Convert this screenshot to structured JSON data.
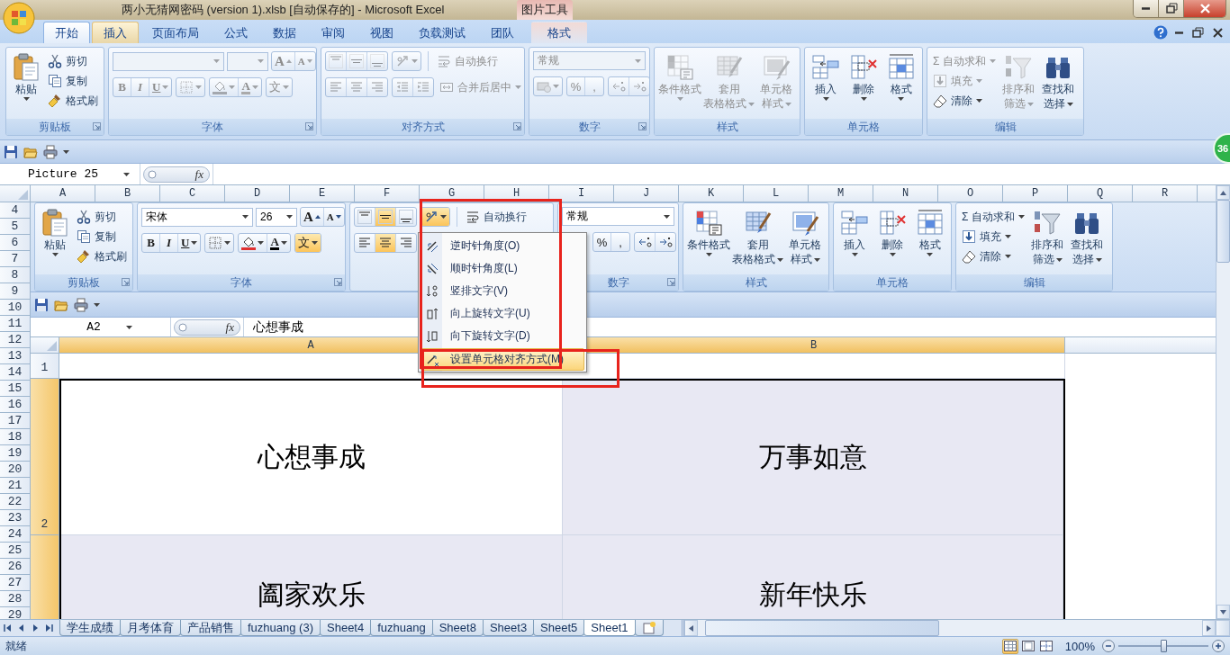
{
  "title_bar": {
    "title": "两小无猜网密码 (version 1).xlsb [自动保存的] - Microsoft Excel",
    "context_label": "图片工具"
  },
  "ribbon_tabs": [
    {
      "label": "开始",
      "selected": true,
      "hovered": false
    },
    {
      "label": "插入",
      "selected": false,
      "hovered": true
    },
    {
      "label": "页面布局",
      "selected": false,
      "hovered": false
    },
    {
      "label": "公式",
      "selected": false,
      "hovered": false
    },
    {
      "label": "数据",
      "selected": false,
      "hovered": false
    },
    {
      "label": "审阅",
      "selected": false,
      "hovered": false
    },
    {
      "label": "视图",
      "selected": false,
      "hovered": false
    },
    {
      "label": "负载测试",
      "selected": false,
      "hovered": false
    },
    {
      "label": "团队",
      "selected": false,
      "hovered": false
    }
  ],
  "context_tabs": [
    {
      "label": "格式",
      "selected": false,
      "hovered": false
    }
  ],
  "ribbon": {
    "clipboard": {
      "label": "剪贴板",
      "paste": {
        "label": "粘贴"
      },
      "cut": {
        "label": "剪切"
      },
      "copy": {
        "label": "复制"
      },
      "painter": {
        "label": "格式刷"
      }
    },
    "font": {
      "label": "字体",
      "disabled": true,
      "grow": "A",
      "shrink": "A",
      "bold": "B",
      "italic": "I",
      "underline": "U",
      "font_color": "A",
      "phonetic": {
        "glyph": "文",
        "pressed": false
      }
    },
    "alignment": {
      "label": "对齐方式",
      "disabled": true,
      "top": {
        "pressed": false
      },
      "middle": {
        "pressed": false
      },
      "bottom": {
        "pressed": false
      },
      "orientation": {
        "pressed": false
      },
      "left": {
        "pressed": false
      },
      "center": {
        "pressed": false
      },
      "right": {
        "pressed": false
      },
      "wrap": {
        "label": "自动换行"
      },
      "merge": {
        "label": "合并后居中"
      }
    },
    "number": {
      "label": "数字",
      "disabled": true,
      "format": {
        "value": "常规"
      },
      "currency": {
        "dropdown": true
      },
      "percent": "%",
      "comma": ","
    },
    "styles": {
      "label": "样式",
      "disabled": true,
      "conditional": {
        "lines": [
          "条件格式"
        ]
      },
      "table": {
        "lines": [
          "套用",
          "表格格式"
        ]
      },
      "cell_styles": {
        "lines": [
          "单元格",
          "样式"
        ]
      }
    },
    "cells": {
      "label": "单元格",
      "insert": {
        "lines": [
          "插入"
        ]
      },
      "delete": {
        "lines": [
          "删除"
        ]
      },
      "format": {
        "lines": [
          "格式"
        ]
      }
    },
    "editing": {
      "label": "编辑",
      "autosum": {
        "icon": "Σ",
        "label": "自动求和",
        "disabled": true
      },
      "fill": {
        "label": "填充",
        "disabled": true
      },
      "clear": {
        "label": "清除",
        "disabled": false
      },
      "sort": {
        "lines": [
          "排序和",
          "筛选"
        ],
        "disabled": true
      },
      "find": {
        "lines": [
          "查找和",
          "选择"
        ],
        "disabled": false
      }
    }
  },
  "formula_bar": {
    "name_box": "Picture 25",
    "function_label": "fx"
  },
  "columns": [
    "A",
    "B",
    "C",
    "D",
    "E",
    "F",
    "G",
    "H",
    "I",
    "J",
    "K",
    "L",
    "M",
    "N",
    "O",
    "P",
    "Q",
    "R"
  ],
  "rows": [
    "4",
    "5",
    "6",
    "7",
    "8",
    "9",
    "10",
    "11",
    "12",
    "13",
    "14",
    "15",
    "16",
    "17",
    "18",
    "19",
    "20",
    "21",
    "22",
    "23",
    "24",
    "25",
    "26",
    "27",
    "28",
    "29"
  ],
  "picture": {
    "ribbon": {
      "clipboard": {
        "label": "剪贴板",
        "paste": {
          "label": "粘贴"
        },
        "cut": {
          "label": "剪切"
        },
        "copy": {
          "label": "复制"
        },
        "painter": {
          "label": "格式刷"
        }
      },
      "font": {
        "label": "字体",
        "disabled": false,
        "font_name": "宋体",
        "font_size": "26",
        "grow": "A",
        "shrink": "A",
        "bold": "B",
        "italic": "I",
        "underline": "U",
        "font_color": "A",
        "phonetic": {
          "glyph": "文",
          "pressed": true
        }
      },
      "alignment": {
        "disabled": false,
        "top": {
          "pressed": false
        },
        "middle": {
          "pressed": true
        },
        "bottom": {
          "pressed": false
        },
        "orientation": {
          "pressed": true
        },
        "left": {
          "pressed": false
        },
        "center": {
          "pressed": true
        },
        "right": {
          "pressed": false
        },
        "wrap": {
          "label": "自动换行"
        }
      },
      "number": {
        "label": "数字",
        "disabled": false,
        "format": {
          "value": "常规"
        },
        "percent": "%",
        "comma": ","
      },
      "styles": {
        "label": "样式",
        "disabled": false,
        "conditional": {
          "lines": [
            "条件格式"
          ]
        },
        "table": {
          "lines": [
            "套用",
            "表格格式"
          ]
        },
        "cell_styles": {
          "lines": [
            "单元格",
            "样式"
          ]
        }
      },
      "cells": {
        "label": "单元格",
        "insert": {
          "lines": [
            "插入"
          ]
        },
        "delete": {
          "lines": [
            "删除"
          ]
        },
        "format": {
          "lines": [
            "格式"
          ]
        }
      },
      "editing": {
        "label": "编辑",
        "autosum": {
          "icon": "Σ",
          "label": "自动求和",
          "disabled": false
        },
        "fill": {
          "label": "填充",
          "disabled": false
        },
        "clear": {
          "label": "清除",
          "disabled": false
        },
        "sort": {
          "lines": [
            "排序和",
            "筛选"
          ],
          "disabled": false
        },
        "find": {
          "lines": [
            "查找和",
            "选择"
          ],
          "disabled": false
        }
      }
    },
    "formula_bar": {
      "name_box": "A2",
      "function_label": "fx",
      "formula": "心想事成"
    },
    "columns": [
      {
        "label": "A",
        "selected": true
      },
      {
        "label": "B",
        "selected": true
      }
    ],
    "rows": [
      {
        "label": "1",
        "selected": false
      },
      {
        "label": "2",
        "selected": true,
        "cells": [
          {
            "text": "心想事成",
            "active": true
          },
          {
            "text": "万事如意",
            "active": false
          }
        ]
      },
      {
        "selected": true,
        "cells": [
          {
            "text": "阖家欢乐",
            "active": false
          },
          {
            "text": "新年快乐",
            "active": false
          }
        ]
      }
    ]
  },
  "text_direction_menu": {
    "items": [
      {
        "label": "逆时针角度(O)",
        "highlighted": false
      },
      {
        "label": "顺时针角度(L)",
        "highlighted": false
      },
      {
        "label": "竖排文字(V)",
        "highlighted": false
      },
      {
        "label": "向上旋转文字(U)",
        "highlighted": false
      },
      {
        "label": "向下旋转文字(D)",
        "highlighted": false
      },
      {
        "label": "设置单元格对齐方式(M)",
        "highlighted": true
      }
    ]
  },
  "annotation_frames": [
    {
      "kind": "frame"
    },
    {
      "kind": "frame"
    }
  ],
  "badge": {
    "text": "36"
  },
  "sheet_tabs": [
    {
      "label": "学生成绩",
      "selected": false
    },
    {
      "label": "月考体育",
      "selected": false
    },
    {
      "label": "产品销售",
      "selected": false
    },
    {
      "label": "fuzhuang (3)",
      "selected": false
    },
    {
      "label": "Sheet4",
      "selected": false
    },
    {
      "label": "fuzhuang",
      "selected": false
    },
    {
      "label": "Sheet8",
      "selected": false
    },
    {
      "label": "Sheet3",
      "selected": false
    },
    {
      "label": "Sheet5",
      "selected": false
    },
    {
      "label": "Sheet1",
      "selected": true
    }
  ],
  "status_bar": {
    "status": "就绪",
    "views": [
      {
        "selected": true
      },
      {
        "selected": false
      },
      {
        "selected": false
      }
    ],
    "zoom": "100%",
    "level": 0.5
  }
}
